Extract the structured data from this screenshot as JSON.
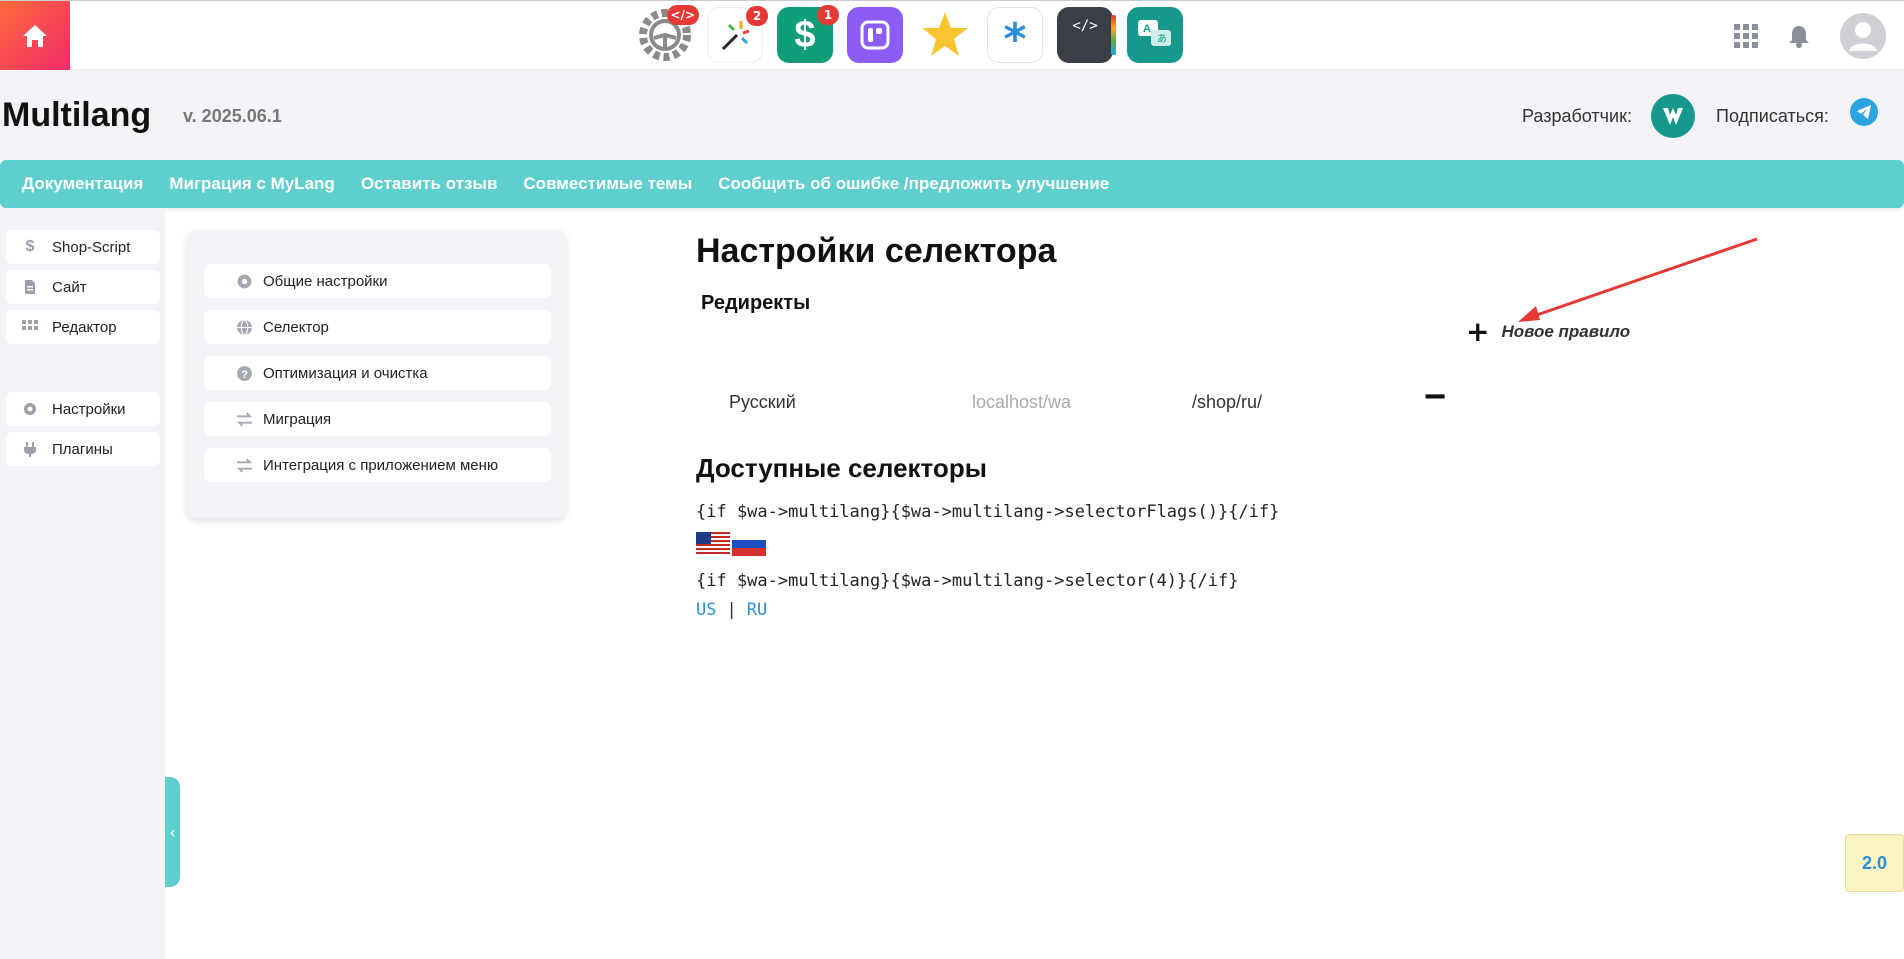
{
  "topbar": {
    "apps": [
      {
        "name": "settings-gear-icon",
        "badge": ""
      },
      {
        "name": "magic-wand-icon",
        "badge": "2"
      },
      {
        "name": "dollar-shop-icon",
        "badge": "1"
      },
      {
        "name": "dashboard-icon",
        "badge": ""
      },
      {
        "name": "star-icon",
        "badge": ""
      },
      {
        "name": "asterisk-icon",
        "badge": ""
      },
      {
        "name": "code-book-icon",
        "badge": ""
      },
      {
        "name": "translate-icon",
        "badge": ""
      }
    ]
  },
  "header": {
    "title": "Multilang",
    "version": "v. 2025.06.1",
    "developer_label": "Разработчик:",
    "subscribe_label": "Подписаться:"
  },
  "nav": {
    "items": [
      "Документация",
      "Миграция с MyLang",
      "Оставить отзыв",
      "Совместимые темы",
      "Сообщить об ошибке /предложить улучшение"
    ]
  },
  "sidebar": {
    "items": [
      "Shop-Script",
      "Сайт",
      "Редактор",
      "Настройки",
      "Плагины"
    ]
  },
  "settings_menu": {
    "items": [
      "Общие настройки",
      "Селектор",
      "Оптимизация и очистка",
      "Миграция",
      "Интеграция с приложением меню"
    ]
  },
  "main": {
    "title": "Настройки селектора",
    "redirects_title": "Редиректы",
    "new_rule_label": "Новое правило",
    "rule": {
      "language": "Русский",
      "domain": "localhost/wa",
      "path": "/shop/ru/"
    },
    "selectors_title": "Доступные селекторы",
    "code_flags": "{if $wa->multilang}{$wa->multilang->selectorFlags()}{/if}",
    "code_selector": "{if $wa->multilang}{$wa->multilang->selector(4)}{/if}",
    "lang_us": "US",
    "lang_sep": "|",
    "lang_ru": "RU"
  },
  "version_badge": "2.0",
  "colors": {
    "teal": "#5ecfcd",
    "home_gradient_start": "#ff6a3d",
    "home_gradient_end": "#f02a6a",
    "link": "#2a8fd8"
  }
}
